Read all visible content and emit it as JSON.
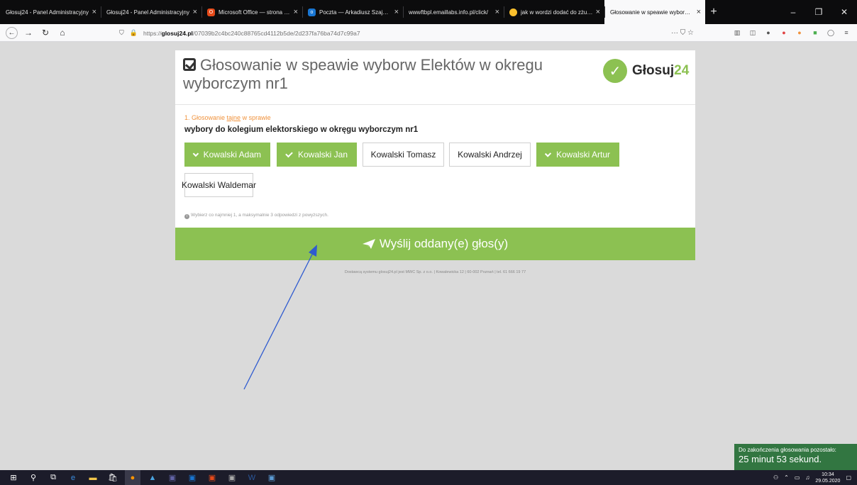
{
  "browser": {
    "tabs": [
      {
        "title": "Głosuj24 - Panel Administracyjny",
        "active": false,
        "icon": "none"
      },
      {
        "title": "Głosuj24 - Panel Administracyjny",
        "active": false,
        "icon": "none"
      },
      {
        "title": "Microsoft Office — strona głó",
        "active": false,
        "icon": "office-icon"
      },
      {
        "title": "Poczta — Arkadiusz Szajewski",
        "active": false,
        "icon": "outlook-icon"
      },
      {
        "title": "wwwftbpl.emaillabs.info.pl/click/",
        "active": false,
        "icon": "none"
      },
      {
        "title": "jak w wordzi dodać do zżutu ek",
        "active": false,
        "icon": "chrome-icon"
      },
      {
        "title": "Głosowanie w speawie wyborw Ele",
        "active": true,
        "icon": "none"
      }
    ],
    "new_tab": "+",
    "url_host": "glosuj24.pl",
    "url_prefix": "https://",
    "url_path": "/07039b2c4bc240c88765cd4112b5de/2d237fa76ba74d7c99a7",
    "page_actions": "··· ⛉ ☆"
  },
  "page": {
    "title": "Głosowanie w speawie wyborw Elektów w okregu wyborczym nr1",
    "logo_text": "Głosuj",
    "logo_num": "24",
    "question_prefix": "1. Głosowanie ",
    "question_secret": "tajne",
    "question_suffix": " w sprawie",
    "question_title": "wybory do kolegium elektorskiego w okręgu wyborczym nr1",
    "options": [
      {
        "label": "Kowalski Adam",
        "selected": true
      },
      {
        "label": "Kowalski Jan",
        "selected": true
      },
      {
        "label": "Kowalski Tomasz",
        "selected": false
      },
      {
        "label": "Kowalski Andrzej",
        "selected": false
      },
      {
        "label": "Kowalski Artur",
        "selected": true
      },
      {
        "label": "Kowalski Waldemar",
        "selected": false
      }
    ],
    "hint": "Wybierz co najmniej 1, a maksymalnie 3 odpowiedzi z powyższych.",
    "submit_label": "Wyślij oddany(e) głos(y)",
    "footer": "Dostawcą systemu glosuj24.pl jest MWC Sp. z o.o. | Kowalewicka 12 | 60-002 Poznań | tel. 61 666 19 77"
  },
  "timer": {
    "label": "Do zakończenia głosowania pozostało:",
    "value": "25 minut 53 sekund."
  },
  "taskbar": {
    "time": "10:34",
    "date": "29.05.2020"
  },
  "colors": {
    "accent_green": "#8cc152",
    "timer_green": "#327641",
    "question_orange": "#f0923c",
    "arrow_blue": "#2f5bd0"
  }
}
